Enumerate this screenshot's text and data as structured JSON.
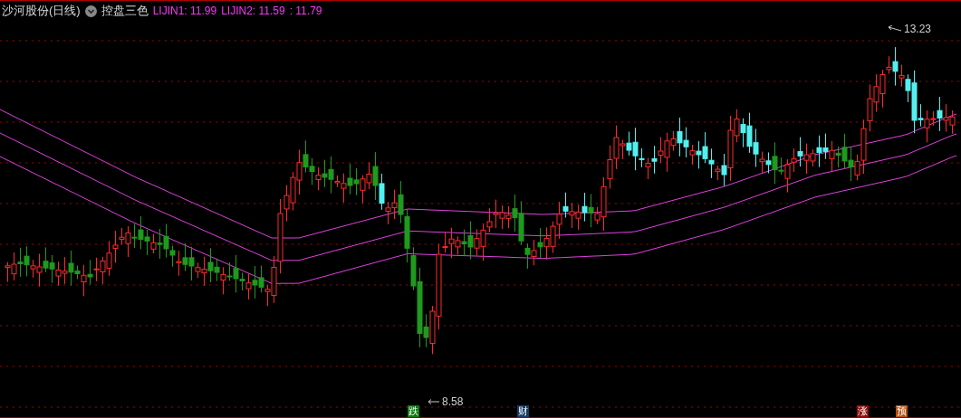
{
  "header": {
    "title": "沙河股份(日线)",
    "indicator": "控盘三色",
    "values": [
      {
        "text": "LIJIN1: 11.99"
      },
      {
        "text": "LIJIN2: 11.59"
      },
      {
        "text": ": 11.79"
      }
    ]
  },
  "chart": {
    "high_label": "13.23",
    "low_label": "8.58",
    "markers": [
      {
        "text": "跌",
        "color": "#0f7a0f"
      },
      {
        "text": "财",
        "color": "#163d66"
      },
      {
        "text": "涨",
        "color": "#8a0f0f"
      },
      {
        "text": "预",
        "color": "#b5500f"
      }
    ]
  }
}
